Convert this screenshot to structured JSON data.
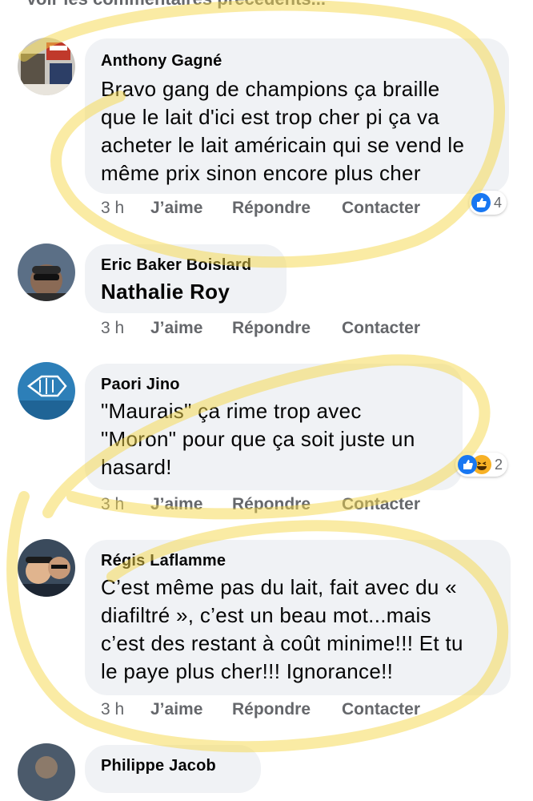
{
  "top_link": "Voir les commentaires précédents...",
  "comments": [
    {
      "author": "Anthony Gagné",
      "lines": [
        "Bravo gang de champions ça braille",
        "que le lait d'ici est trop cher pi ça va",
        "acheter le lait américain qui se vend le",
        "même prix sinon encore plus cher"
      ],
      "time": "3 h",
      "like": "J’aime",
      "reply": "Répondre",
      "contact": "Contacter",
      "reaction_count": "4"
    },
    {
      "author": "Eric Baker Boislard",
      "lines": [
        "Nathalie Roy"
      ],
      "time": "3 h",
      "like": "J’aime",
      "reply": "Répondre",
      "contact": "Contacter"
    },
    {
      "author": "Paori Jino",
      "lines": [
        "\"Maurais\" ça rime trop avec",
        "\"Moron\" pour que ça soit juste un",
        "hasard!"
      ],
      "time": "3 h",
      "like": "J’aime",
      "reply": "Répondre",
      "contact": "Contacter",
      "reaction_count": "2"
    },
    {
      "author": "Régis Laflamme",
      "lines": [
        "C’est même pas du lait, fait avec du «",
        "diafiltré », c’est un beau mot...mais",
        "c’est des restant à coût minime!!! Et tu",
        "le paye plus cher!!! Ignorance!!"
      ],
      "time": "3 h",
      "like": "J’aime",
      "reply": "Répondre",
      "contact": "Contacter"
    },
    {
      "author": "Philippe Jacob"
    }
  ],
  "colors": {
    "bubble": "#f0f2f5",
    "secondary_text": "#65676b",
    "like_blue": "#1877f2",
    "haha_yellow": "#f7b125",
    "highlighter": "#f5d84a"
  }
}
